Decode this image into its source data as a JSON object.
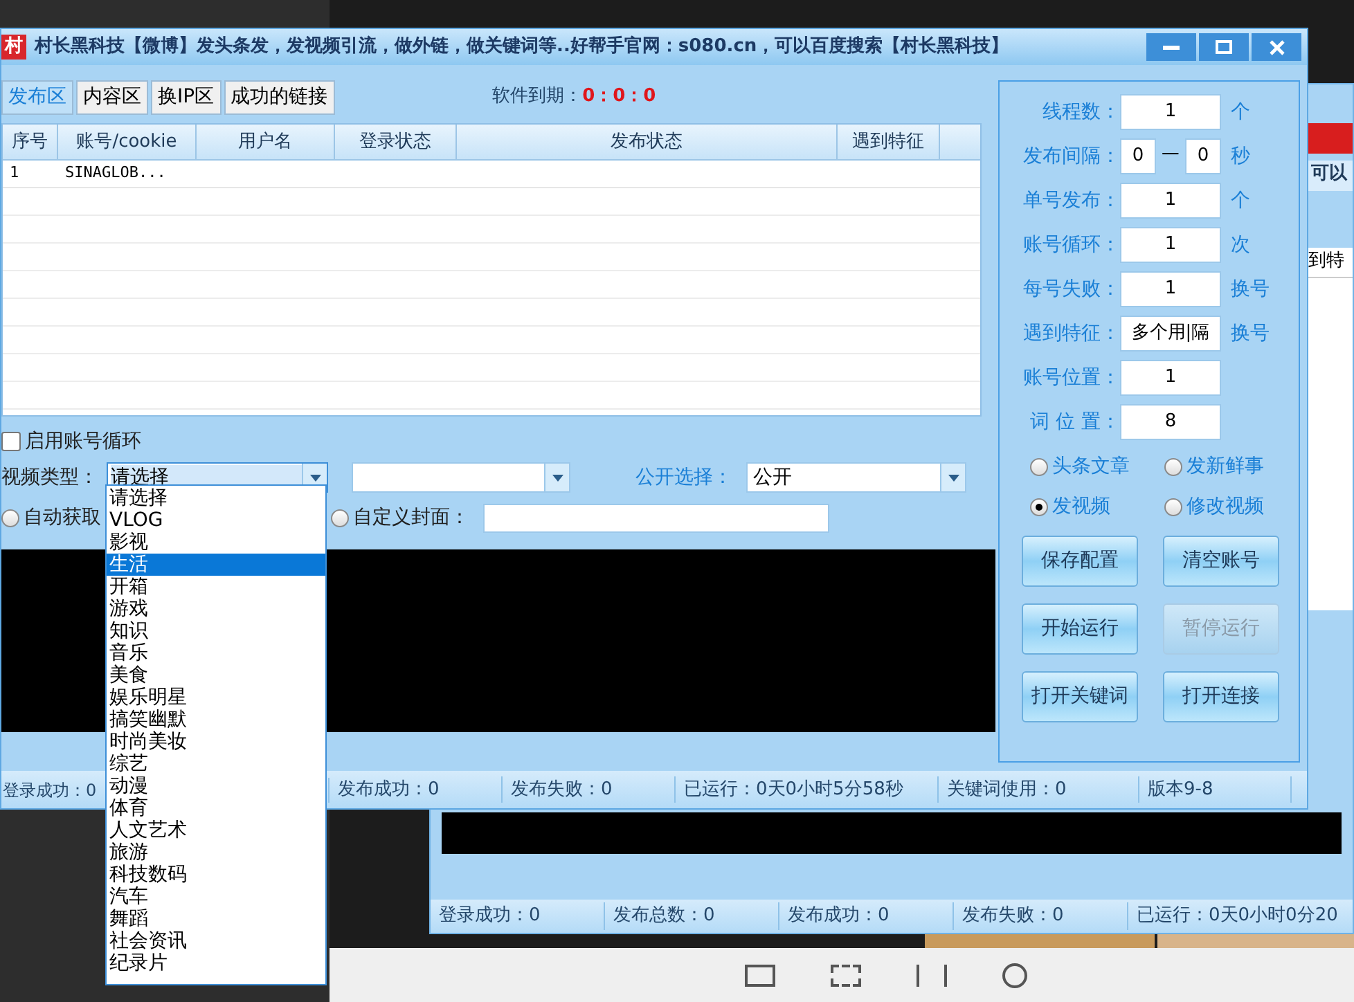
{
  "main_window": {
    "logo": "村",
    "title": "村长黑科技【微博】发头条发，发视频引流，做外链，做关键词等..好帮手官网：s080.cn，可以百度搜索【村长黑科技】"
  },
  "tabs": [
    {
      "label": "发布区",
      "selected": true
    },
    {
      "label": "内容区",
      "selected": false
    },
    {
      "label": "换IP区",
      "selected": false
    },
    {
      "label": "成功的链接",
      "selected": false
    }
  ],
  "expiry": {
    "label": "软件到期：",
    "value": "0：0：0"
  },
  "table": {
    "columns": [
      "序号",
      "账号/cookie",
      "用户名",
      "登录状态",
      "发布状态",
      "遇到特征"
    ],
    "rows": [
      [
        "1",
        "SINAGLOB..."
      ]
    ]
  },
  "account_loop": {
    "label": "启用账号循环",
    "checked": false
  },
  "video_type": {
    "label": "视频类型：",
    "value": "请选择",
    "expanded": true
  },
  "public_select": {
    "label": "公开选择：",
    "value": "公开"
  },
  "cover_options": [
    {
      "label": "自动获取",
      "selected": false
    },
    {
      "label": "自定义封面：",
      "selected": false
    }
  ],
  "video_type_options": [
    {
      "label": "请选择",
      "selected": false
    },
    {
      "label": "VLOG",
      "selected": false
    },
    {
      "label": "影视",
      "selected": false
    },
    {
      "label": "生活",
      "selected": true
    },
    {
      "label": "开箱",
      "selected": false
    },
    {
      "label": "游戏",
      "selected": false
    },
    {
      "label": "知识",
      "selected": false
    },
    {
      "label": "音乐",
      "selected": false
    },
    {
      "label": "美食",
      "selected": false
    },
    {
      "label": "娱乐明星",
      "selected": false
    },
    {
      "label": "搞笑幽默",
      "selected": false
    },
    {
      "label": "时尚美妆",
      "selected": false
    },
    {
      "label": "综艺",
      "selected": false
    },
    {
      "label": "动漫",
      "selected": false
    },
    {
      "label": "体育",
      "selected": false
    },
    {
      "label": "人文艺术",
      "selected": false
    },
    {
      "label": "旅游",
      "selected": false
    },
    {
      "label": "科技数码",
      "selected": false
    },
    {
      "label": "汽车",
      "selected": false
    },
    {
      "label": "舞蹈",
      "selected": false
    },
    {
      "label": "社会资讯",
      "selected": false
    },
    {
      "label": "纪录片",
      "selected": false
    }
  ],
  "status_bar": [
    "登录成功：0",
    "发布成功：0",
    "发布失败：0",
    "已运行：0天0小时5分58秒",
    "关键词使用：0",
    "版本9-8"
  ],
  "settings": [
    {
      "kind": "single",
      "label": "线程数：",
      "value": "1",
      "unit": "个"
    },
    {
      "kind": "range",
      "label": "发布间隔：",
      "from": "0",
      "separator": "一",
      "to": "0",
      "unit": "秒"
    },
    {
      "kind": "single",
      "label": "单号发布：",
      "value": "1",
      "unit": "个"
    },
    {
      "kind": "single",
      "label": "账号循环：",
      "value": "1",
      "unit": "次"
    },
    {
      "kind": "single",
      "label": "每号失败：",
      "value": "1",
      "unit": "换号"
    },
    {
      "kind": "single",
      "label": "遇到特征：",
      "value": "多个用|隔",
      "unit": "换号"
    },
    {
      "kind": "single",
      "label": "账号位置：",
      "value": "1"
    },
    {
      "kind": "single",
      "label": "词 位 置：",
      "value": "8"
    }
  ],
  "modes": [
    {
      "label": "头条文章",
      "selected": false
    },
    {
      "label": "发新鲜事",
      "selected": false
    },
    {
      "label": "发视频",
      "selected": true
    },
    {
      "label": "修改视频",
      "selected": false
    }
  ],
  "buttons": [
    {
      "label": "保存配置",
      "disabled": false
    },
    {
      "label": "清空账号",
      "disabled": false
    },
    {
      "label": "开始运行",
      "disabled": false
    },
    {
      "label": "暂停运行",
      "disabled": true
    },
    {
      "label": "打开关键词",
      "disabled": false
    },
    {
      "label": "打开连接",
      "disabled": false
    }
  ],
  "background_window": {
    "tab": "可以",
    "column": "到特",
    "status_bar": [
      "登录成功：0",
      "发布总数：0",
      "发布成功：0",
      "发布失败：0",
      "已运行：0天0小时0分20"
    ]
  }
}
